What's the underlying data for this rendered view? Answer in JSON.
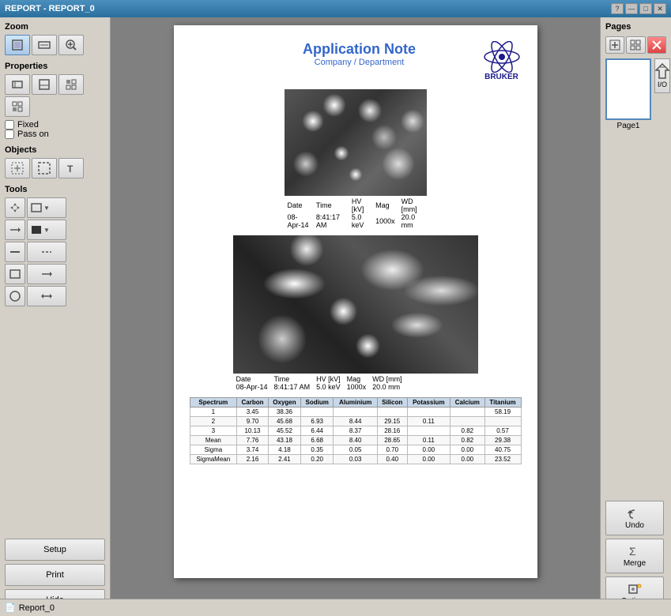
{
  "titlebar": {
    "title": "REPORT - REPORT_0",
    "buttons": [
      "?",
      "□",
      "✕"
    ]
  },
  "zoom": {
    "label": "Zoom",
    "buttons": [
      "fit-page",
      "fit-width",
      "zoom-in"
    ]
  },
  "properties": {
    "label": "Properties",
    "buttons": [
      "prop1",
      "prop2",
      "prop3",
      "prop4"
    ],
    "fixed_label": "Fixed",
    "pass_on_label": "Pass on"
  },
  "objects": {
    "label": "Objects"
  },
  "tools": {
    "label": "Tools"
  },
  "bottom_buttons": {
    "setup": "Setup",
    "print": "Print",
    "hide": "Hide"
  },
  "pages": {
    "label": "Pages",
    "io_label": "I/O",
    "page1_label": "Page1"
  },
  "right_buttons": {
    "undo": "Undo",
    "merge": "Merge",
    "options": "Options"
  },
  "status_bar": {
    "filename": "Report_0"
  },
  "report_page": {
    "app_note_title": "Application Note",
    "app_note_subtitle": "Company / Department",
    "bruker_text": "BRUKER",
    "image1": {
      "date_label": "Date",
      "time_label": "Time",
      "hv_label": "HV [kV]",
      "mag_label": "Mag",
      "wd_label": "WD [mm]",
      "date_val": "08-Apr-14",
      "time_val": "8:41:17 AM",
      "hv_val": "5.0 keV",
      "mag_val": "1000x",
      "wd_val": "20.0 mm"
    },
    "image2": {
      "date_label": "Date",
      "time_label": "Time",
      "hv_label": "HV [kV]",
      "mag_label": "Mag",
      "wd_label": "WD [mm]",
      "date_val": "08-Apr-14",
      "time_val": "8:41:17 AM",
      "hv_val": "5.0 keV",
      "mag_val": "1000x",
      "wd_val": "20.0 mm"
    },
    "table": {
      "headers": [
        "Spectrum",
        "Carbon",
        "Oxygen",
        "Sodium",
        "Aluminium",
        "Silicon",
        "Potassium",
        "Calcium",
        "Titanium"
      ],
      "rows": [
        [
          "1",
          "3.45",
          "38.36",
          "",
          "",
          "",
          "",
          "",
          "58.19"
        ],
        [
          "2",
          "9.70",
          "45.68",
          "6.93",
          "8.44",
          "29.15",
          "0.11",
          "",
          ""
        ],
        [
          "3",
          "10.13",
          "45.52",
          "6.44",
          "8.37",
          "28.16",
          "",
          "0.82",
          "0.57"
        ],
        [
          "Mean",
          "7.76",
          "43.18",
          "6.68",
          "8.40",
          "28.65",
          "0.11",
          "0.82",
          "29.38"
        ],
        [
          "Sigma",
          "3.74",
          "4.18",
          "0.35",
          "0.05",
          "0.70",
          "0.00",
          "0.00",
          "40.75"
        ],
        [
          "SigmaMean",
          "2.16",
          "2.41",
          "0.20",
          "0.03",
          "0.40",
          "0.00",
          "0.00",
          "23.52"
        ]
      ]
    }
  }
}
